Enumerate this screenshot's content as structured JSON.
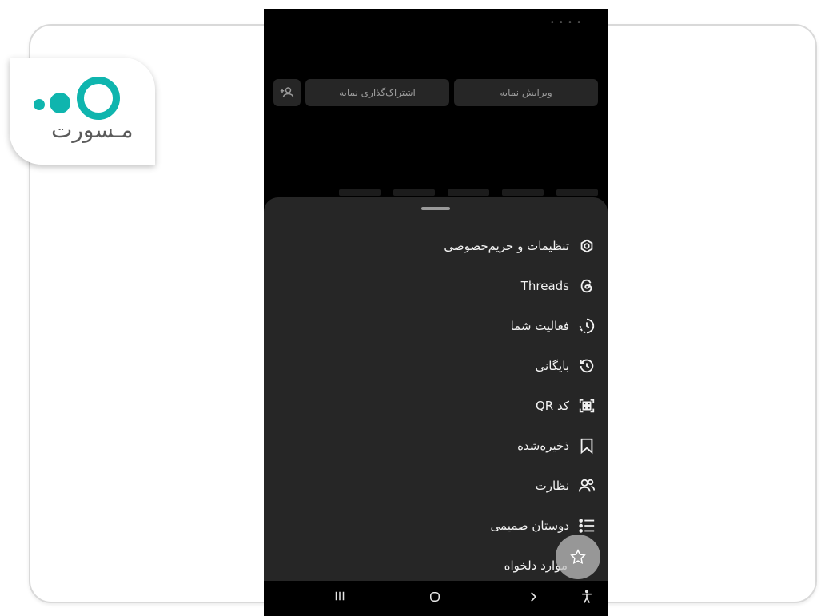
{
  "logo": {
    "wordmark": "مـسورت",
    "accent_color": "#0fb5ae"
  },
  "profile": {
    "buttons": {
      "add_person_icon": "add-person-icon",
      "share_label": "اشتراک‌گذاری نمایه",
      "edit_label": "ویرایش نمایه"
    }
  },
  "menu": {
    "items": [
      {
        "label": "تنظیمات و حریم‌خصوصی",
        "icon": "settings-gear-icon"
      },
      {
        "label": "Threads",
        "icon": "threads-icon"
      },
      {
        "label": "فعالیت شما",
        "icon": "activity-icon"
      },
      {
        "label": "بایگانی",
        "icon": "archive-icon"
      },
      {
        "label": "کد QR",
        "icon": "qr-code-icon"
      },
      {
        "label": "ذخیره‌شده",
        "icon": "bookmark-icon"
      },
      {
        "label": "نظارت",
        "icon": "supervision-icon"
      },
      {
        "label": "دوستان صمیمی",
        "icon": "close-friends-list-icon"
      },
      {
        "label": "موارد دلخواه",
        "icon": "favorites-star-icon"
      }
    ]
  },
  "navbar": {
    "recents_icon": "recents-icon",
    "home_icon": "home-icon",
    "back_icon": "back-icon",
    "accessibility_icon": "accessibility-icon"
  },
  "colors": {
    "sheet_bg": "#262626",
    "screen_bg": "#000000",
    "text_primary": "#f2f2f2"
  }
}
